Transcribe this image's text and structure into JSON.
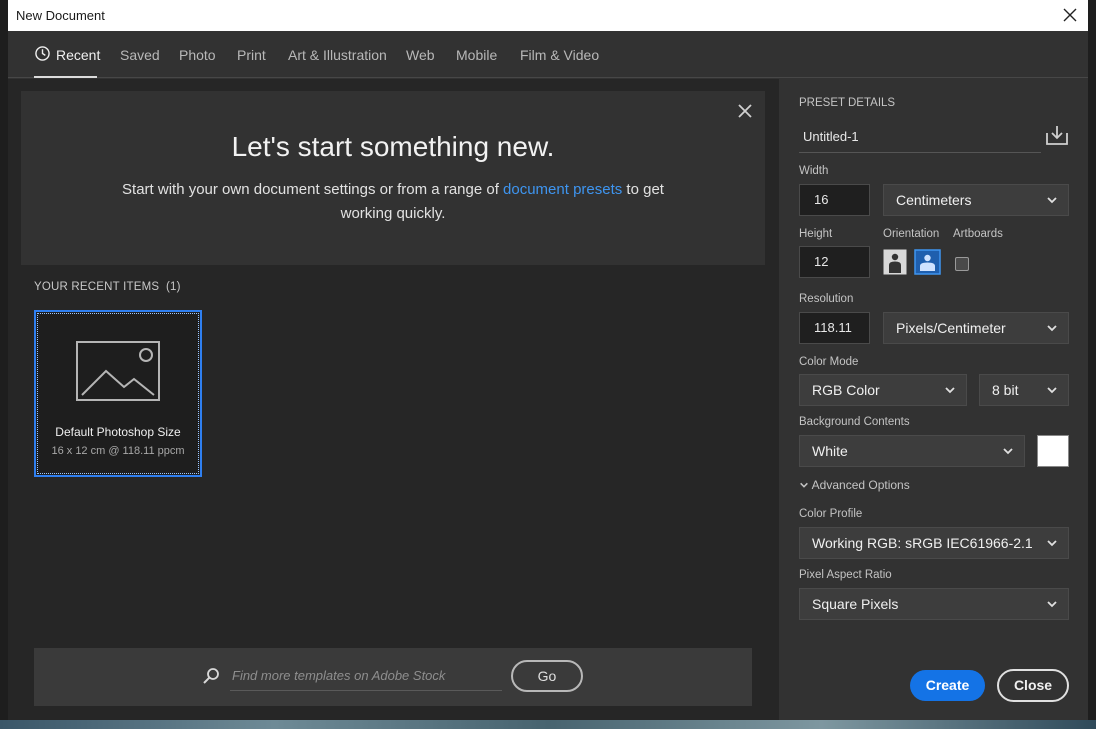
{
  "window": {
    "title": "New Document"
  },
  "tabs": [
    {
      "label": "Recent"
    },
    {
      "label": "Saved"
    },
    {
      "label": "Photo"
    },
    {
      "label": "Print"
    },
    {
      "label": "Art & Illustration"
    },
    {
      "label": "Web"
    },
    {
      "label": "Mobile"
    },
    {
      "label": "Film & Video"
    }
  ],
  "hero": {
    "title": "Let's start something new.",
    "text_before": "Start with your own document settings or from a range of ",
    "link": "document presets",
    "text_after": " to get working quickly."
  },
  "recent": {
    "header": "YOUR RECENT ITEMS",
    "count": "(1)",
    "items": [
      {
        "name": "Default Photoshop Size",
        "meta": "16 x 12 cm @ 118.11 ppcm"
      }
    ]
  },
  "search": {
    "placeholder": "Find more templates on Adobe Stock",
    "go_label": "Go"
  },
  "preset": {
    "header": "PRESET DETAILS",
    "name": "Untitled-1",
    "width_label": "Width",
    "width_value": "16",
    "width_unit": "Centimeters",
    "height_label": "Height",
    "height_value": "12",
    "orientation_label": "Orientation",
    "artboards_label": "Artboards",
    "resolution_label": "Resolution",
    "resolution_value": "118.11",
    "resolution_unit": "Pixels/Centimeter",
    "color_mode_label": "Color Mode",
    "color_mode": "RGB Color",
    "bit_depth": "8 bit",
    "background_label": "Background Contents",
    "background": "White",
    "advanced_label": "Advanced Options",
    "color_profile_label": "Color Profile",
    "color_profile": "Working RGB: sRGB IEC61966-2.1",
    "pixel_aspect_label": "Pixel Aspect Ratio",
    "pixel_aspect": "Square Pixels"
  },
  "actions": {
    "create": "Create",
    "close": "Close"
  },
  "colors": {
    "accent": "#1473e6",
    "link": "#3e95f0",
    "selection": "#2f7ff0"
  }
}
